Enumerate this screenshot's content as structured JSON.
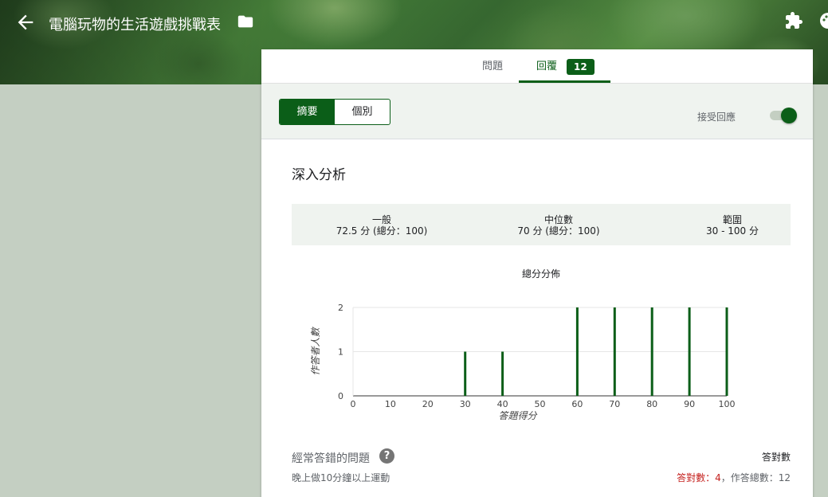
{
  "header": {
    "title": "電腦玩物的生活遊戲挑戰表",
    "icons": [
      "back-arrow-icon",
      "folder-icon",
      "puzzle-addon-icon",
      "palette-icon"
    ]
  },
  "tabs": {
    "questions": "問題",
    "responses": "回覆",
    "response_count": "12"
  },
  "toolbar": {
    "summary": "摘要",
    "individual": "個別",
    "accepting_label": "接受回應",
    "accepting_on": true
  },
  "insights": {
    "title": "深入分析",
    "average_label": "一般",
    "average_value": "72.5 分 (總分：100)",
    "median_label": "中位數",
    "median_value": "70 分 (總分：100)",
    "range_label": "範圍",
    "range_value": "30 - 100 分"
  },
  "chart_data": {
    "type": "bar",
    "title": "總分分佈",
    "xlabel": "答題得分",
    "ylabel": "作答者人數",
    "x_ticks": [
      "0",
      "10",
      "20",
      "30",
      "40",
      "50",
      "60",
      "70",
      "80",
      "90",
      "100"
    ],
    "y_ticks": [
      "0",
      "1",
      "2"
    ],
    "xlim": [
      0,
      100
    ],
    "ylim": [
      0,
      2
    ],
    "x": [
      30,
      40,
      60,
      70,
      80,
      90,
      100
    ],
    "values": [
      1,
      1,
      2,
      2,
      2,
      2,
      2
    ],
    "grid": true,
    "bar_color": "#0b5e18"
  },
  "frequent": {
    "title": "經常答錯的問題",
    "correct_header": "答對數",
    "question": "晚上做10分鐘以上運動",
    "correct_label": "答對數：4",
    "total_label": "，作答總數：12"
  },
  "colors": {
    "accent": "#0b5e18",
    "background": "#c4cfc2",
    "error": "#c5221f"
  }
}
